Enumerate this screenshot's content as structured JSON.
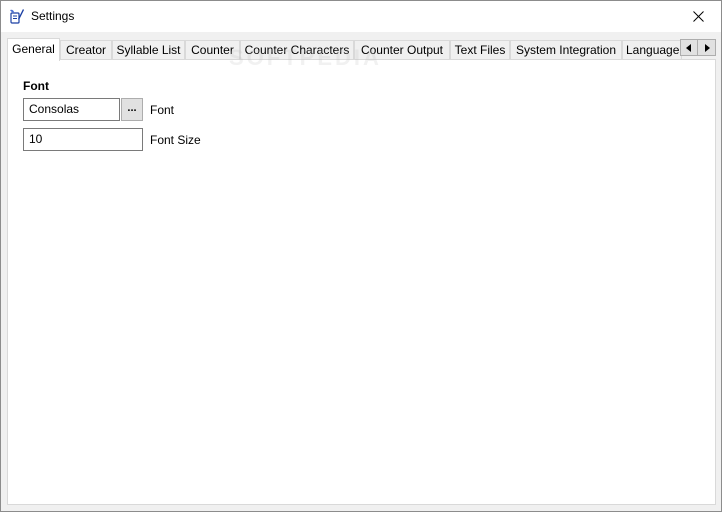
{
  "window": {
    "title": "Settings",
    "icon": "quill-book-icon"
  },
  "tabs": [
    {
      "label": "General",
      "active": true
    },
    {
      "label": "Creator"
    },
    {
      "label": "Syllable List"
    },
    {
      "label": "Counter"
    },
    {
      "label": "Counter Characters"
    },
    {
      "label": "Counter Output"
    },
    {
      "label": "Text Files"
    },
    {
      "label": "System Integration"
    },
    {
      "label": "Language"
    }
  ],
  "general": {
    "section_title": "Font",
    "font_value": "Consolas",
    "browse_label": "...",
    "font_label": "Font",
    "font_size_value": "10",
    "font_size_label": "Font Size"
  },
  "watermark": "SOFTPEDIA",
  "colors": {
    "client_bg": "#f0f0f0",
    "tab_border": "#d9d9d9",
    "icon_blue": "#1a3fa3"
  }
}
